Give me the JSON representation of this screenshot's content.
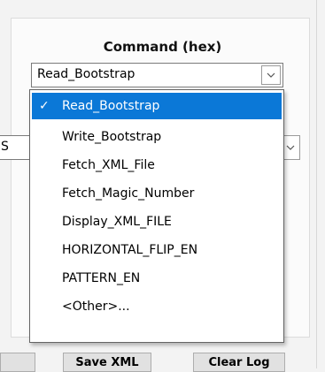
{
  "command": {
    "label": "Command (hex)",
    "selected": "Read_Bootstrap",
    "options": [
      "Read_Bootstrap",
      "Write_Bootstrap",
      "Fetch_XML_File",
      "Fetch_Magic_Number",
      "Display_XML_FILE",
      "HORIZONTAL_FLIP_EN",
      "PATTERN_EN",
      "<Other>..."
    ],
    "check_mark": "✓"
  },
  "second_combo": {
    "partial_value": "S"
  },
  "bottom_buttons": [
    {
      "label": ""
    },
    {
      "label": "Save XML"
    },
    {
      "label": "Clear Log"
    }
  ],
  "colors": {
    "selection": "#0b78d7"
  },
  "icons": {
    "dropdown": "chevron-down-icon"
  }
}
